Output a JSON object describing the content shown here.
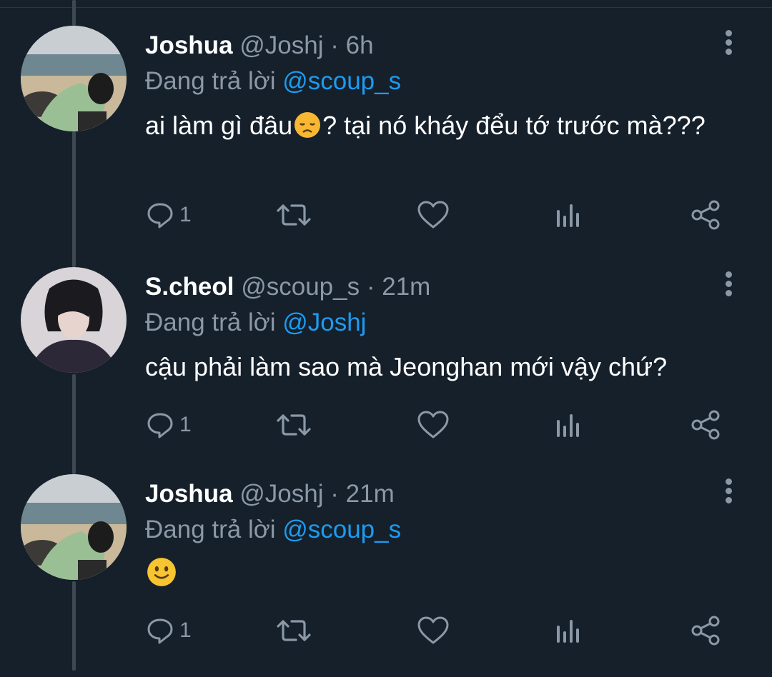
{
  "colors": {
    "background": "#15202b",
    "secondary_text": "#8b98a5",
    "accent": "#1d9bf0",
    "thread_line": "#3d4852"
  },
  "tweets": [
    {
      "name": "Joshua",
      "handle": "@Joshj",
      "separator": "·",
      "time": "6h",
      "reply_prefix": "Đang trả lời",
      "reply_to": "@scoup_s",
      "text_before_emoji": "ai làm gì đâu",
      "emoji": "disappointed-face-emoji",
      "text_after_emoji": "? tại nó kháy đểu tớ trước mà???",
      "reply_count": "1",
      "avatar": "beach-photo-avatar"
    },
    {
      "name": "S.cheol",
      "handle": "@scoup_s",
      "separator": "·",
      "time": "21m",
      "reply_prefix": "Đang trả lời",
      "reply_to": "@Joshj",
      "text": "cậu phải làm sao mà Jeonghan mới vậy chứ?",
      "reply_count": "1",
      "avatar": "portrait-photo-avatar"
    },
    {
      "name": "Joshua",
      "handle": "@Joshj",
      "separator": "·",
      "time": "21m",
      "reply_prefix": "Đang trả lời",
      "reply_to": "@scoup_s",
      "emoji": "slightly-smiling-face-emoji",
      "reply_count": "1",
      "avatar": "beach-photo-avatar"
    }
  ],
  "action_icons": [
    "reply-icon",
    "retweet-icon",
    "like-icon",
    "analytics-icon",
    "share-icon"
  ]
}
